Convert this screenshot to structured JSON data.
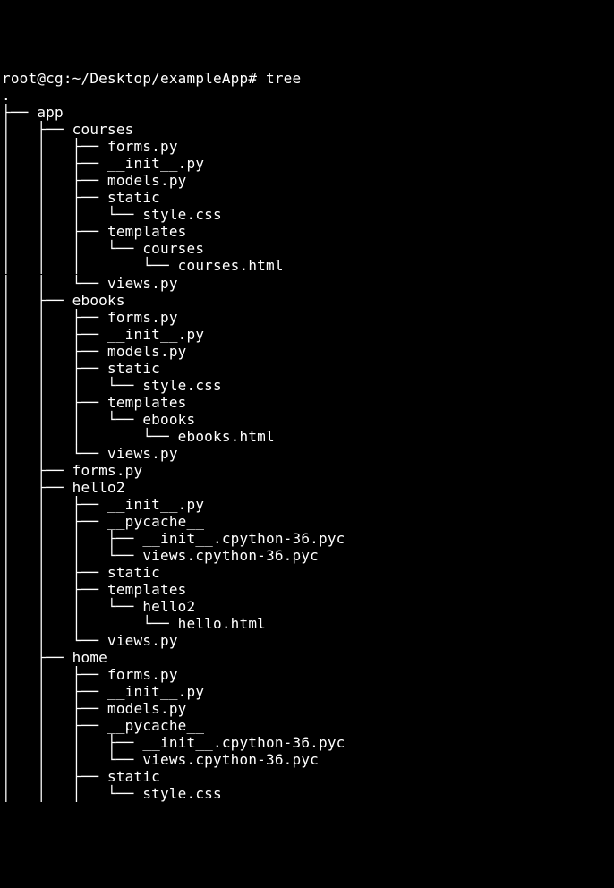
{
  "prompt": "root@cg:~/Desktop/exampleApp# ",
  "command": "tree",
  "lines": [
    ".",
    "├── app",
    "│   ├── courses",
    "│   │   ├── forms.py",
    "│   │   ├── __init__.py",
    "│   │   ├── models.py",
    "│   │   ├── static",
    "│   │   │   └── style.css",
    "│   │   ├── templates",
    "│   │   │   └── courses",
    "│   │   │       └── courses.html",
    "│   │   └── views.py",
    "│   ├── ebooks",
    "│   │   ├── forms.py",
    "│   │   ├── __init__.py",
    "│   │   ├── models.py",
    "│   │   ├── static",
    "│   │   │   └── style.css",
    "│   │   ├── templates",
    "│   │   │   └── ebooks",
    "│   │   │       └── ebooks.html",
    "│   │   └── views.py",
    "│   ├── forms.py",
    "│   ├── hello2",
    "│   │   ├── __init__.py",
    "│   │   ├── __pycache__",
    "│   │   │   ├── __init__.cpython-36.pyc",
    "│   │   │   └── views.cpython-36.pyc",
    "│   │   ├── static",
    "│   │   ├── templates",
    "│   │   │   └── hello2",
    "│   │   │       └── hello.html",
    "│   │   └── views.py",
    "│   ├── home",
    "│   │   ├── forms.py",
    "│   │   ├── __init__.py",
    "│   │   ├── models.py",
    "│   │   ├── __pycache__",
    "│   │   │   ├── __init__.cpython-36.pyc",
    "│   │   │   └── views.cpython-36.pyc",
    "│   │   ├── static",
    "│   │   │   └── style.css"
  ]
}
